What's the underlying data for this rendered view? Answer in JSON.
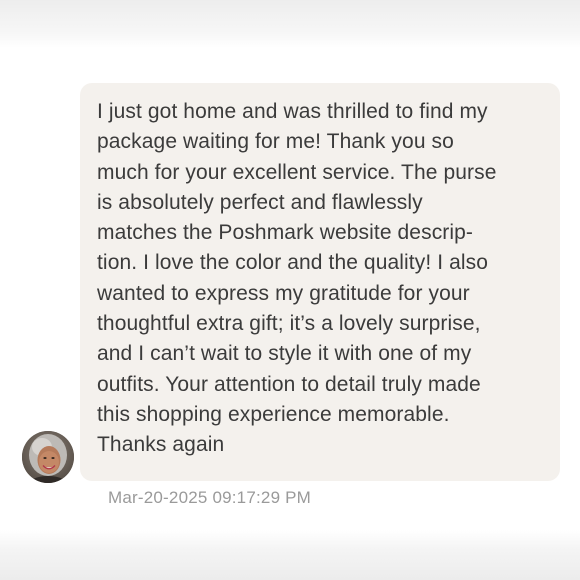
{
  "message": {
    "lines": [
      "I just got home and was thrilled to find my",
      "package waiting for me! Thank you so",
      "much for your excellent service. The purse",
      "is absolutely perfect and flawlessly",
      "matches the Poshmark website descrip-",
      "tion. I love the color and the quality! I also",
      "wanted to express my gratitude for your",
      "thoughtful extra gift; it’s a lovely surprise,",
      "and I can’t wait to style it with one of my",
      "outfits. Your attention to detail truly made",
      "this shopping experience memorable.",
      "Thanks again"
    ],
    "timestamp": "Mar-20-2025 09:17:29 PM"
  },
  "sender": {
    "avatar_icon": "user-avatar-photo"
  },
  "colors": {
    "bubble_background": "#f4f1ed",
    "message_text": "#3b3b3b",
    "timestamp_text": "#9a9a9a"
  }
}
